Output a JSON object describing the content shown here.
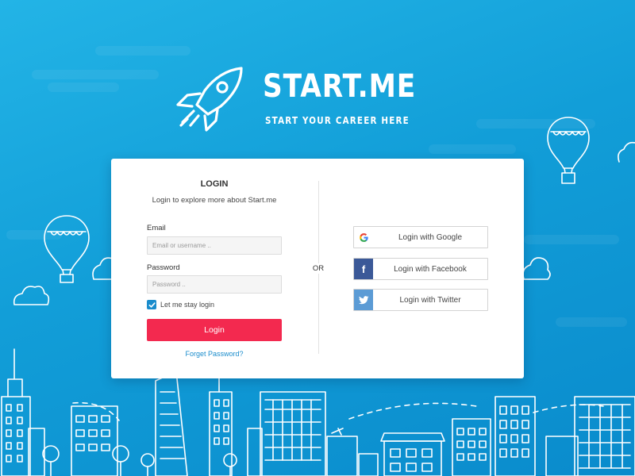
{
  "brand": {
    "title": "START.ME",
    "tagline": "START YOUR CAREER HERE"
  },
  "login": {
    "heading": "LOGIN",
    "subheading": "Login to explore more about Start.me",
    "email_label": "Email",
    "email_placeholder": "Email or username ..",
    "email_value": "",
    "password_label": "Password",
    "password_placeholder": "Password ..",
    "password_value": "",
    "remember_label": "Let me stay login",
    "remember_checked": true,
    "submit_label": "Login",
    "forgot_label": "Forget Password?"
  },
  "divider_text": "OR",
  "social": [
    {
      "label": "Login with Google",
      "icon": "google-icon",
      "color": "#ffffff"
    },
    {
      "label": "Login with Facebook",
      "icon": "facebook-icon",
      "color": "#3b5998"
    },
    {
      "label": "Login with Twitter",
      "icon": "twitter-icon",
      "color": "#5b9bd5"
    }
  ],
  "colors": {
    "background": "#139fd9",
    "primary_button": "#f3294f",
    "link": "#1a8ccc",
    "card": "#ffffff"
  }
}
